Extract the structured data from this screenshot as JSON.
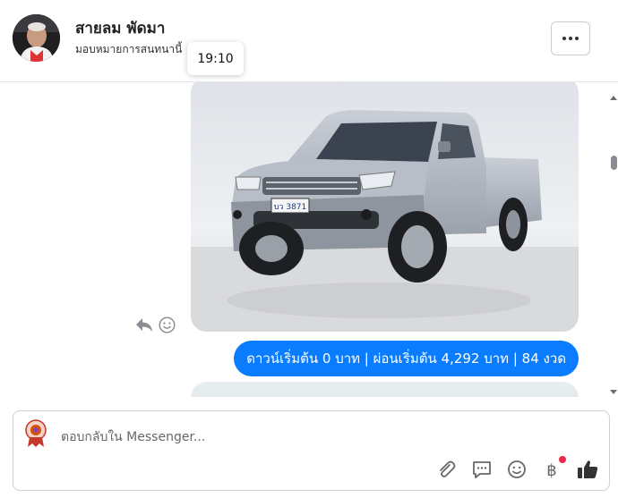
{
  "header": {
    "contact_name": "สายลม พัดมา",
    "subtitle": "มอบหมายการสนทนานี้",
    "more_icon": "more-horizontal-icon"
  },
  "tooltip": {
    "time": "19:10"
  },
  "messages": {
    "image_alt": "silver pickup truck photo",
    "price_text": "ดาวน์เริ่มต้น 0 บาท | ผ่อนเริ่มต้น 4,292 บาท | 84 งวด",
    "plate_text": "บว 3871",
    "actions": [
      "reply-icon",
      "react-smile-icon"
    ]
  },
  "composer": {
    "placeholder": "ตอบกลับใน Messenger...",
    "tools": [
      "attach-icon",
      "saved-replies-icon",
      "emoji-icon",
      "baht-payment-icon",
      "like-icon"
    ]
  },
  "colors": {
    "bubble": "#0a7cff",
    "badge": "#f02849",
    "border": "#ced0d4"
  }
}
